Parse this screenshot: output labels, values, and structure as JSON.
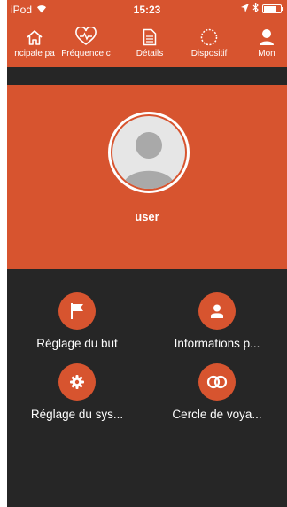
{
  "status": {
    "carrier": "iPod",
    "time": "15:23",
    "battery_level": 0.8
  },
  "tabs": [
    {
      "label": "ncipale pa",
      "icon": "home-icon"
    },
    {
      "label": "Fréquence c",
      "icon": "heart-rate-icon"
    },
    {
      "label": "Détails",
      "icon": "document-icon"
    },
    {
      "label": "Dispositif",
      "icon": "device-circle-icon"
    },
    {
      "label": "Mon",
      "icon": "person-icon"
    }
  ],
  "profile": {
    "username": "user"
  },
  "menu": [
    {
      "label": "Réglage du but",
      "icon": "flag-icon"
    },
    {
      "label": "Informations p...",
      "icon": "person-card-icon"
    },
    {
      "label": "Réglage du sys...",
      "icon": "gear-icon"
    },
    {
      "label": "Cercle de voya...",
      "icon": "linked-rings-icon"
    }
  ],
  "colors": {
    "accent": "#d7542f",
    "dark": "#262626",
    "text": "#ffffff"
  }
}
